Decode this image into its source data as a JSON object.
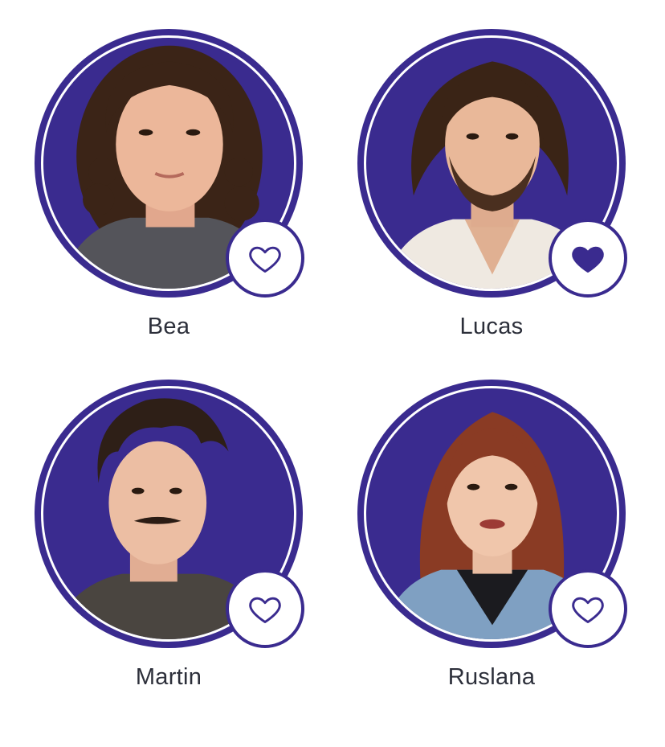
{
  "colors": {
    "accent": "#3a2b8f",
    "ring_inner": "#ffffff",
    "name_text": "#2c2f3a"
  },
  "contestants": [
    {
      "name": "Bea",
      "favorited": false,
      "icon": "heart-outline-icon"
    },
    {
      "name": "Lucas",
      "favorited": true,
      "icon": "heart-filled-icon"
    },
    {
      "name": "Martin",
      "favorited": false,
      "icon": "heart-outline-icon"
    },
    {
      "name": "Ruslana",
      "favorited": false,
      "icon": "heart-outline-icon"
    }
  ]
}
